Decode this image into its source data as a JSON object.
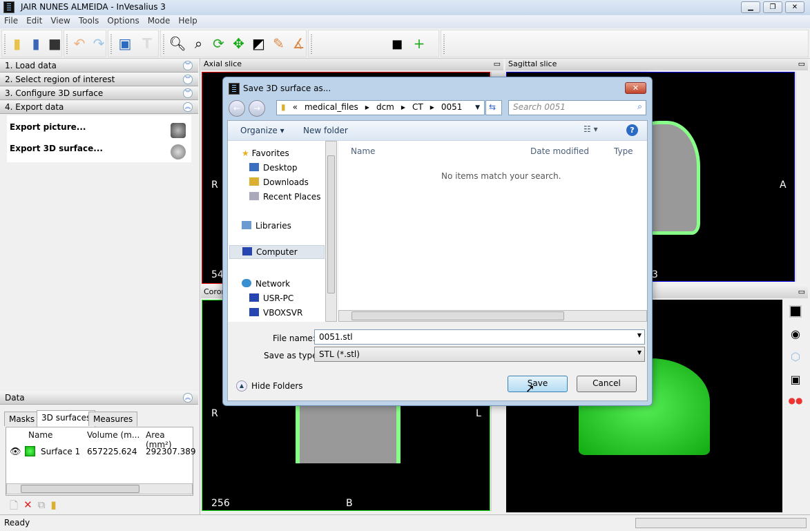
{
  "window": {
    "title": "JAIR NUNES ALMEIDA - InVesalius 3",
    "minimize": "▁",
    "restore": "❐",
    "close": "✕"
  },
  "menu": [
    "File",
    "Edit",
    "View",
    "Tools",
    "Options",
    "Mode",
    "Help"
  ],
  "toolbar": {
    "icons": [
      "import-folder",
      "import-dicom",
      "export",
      "undo",
      "redo",
      "layout",
      "text",
      "zoom",
      "zoom-select",
      "rotate",
      "pan",
      "contrast",
      "measure-distance",
      "measure-angle",
      "slice-tool",
      "add-mark"
    ]
  },
  "left_panel": {
    "sections": [
      {
        "label": "1. Load data"
      },
      {
        "label": "2. Select region of interest"
      },
      {
        "label": "3. Configure 3D surface"
      },
      {
        "label": "4. Export data"
      }
    ],
    "export_items": [
      "Export picture...",
      "Export 3D surface..."
    ],
    "data": {
      "title": "Data",
      "tabs": [
        "Masks",
        "3D surfaces",
        "Measures"
      ],
      "active_tab": "3D surfaces",
      "columns": [
        "Name",
        "Volume (m...",
        "Area (mm²)"
      ],
      "rows": [
        {
          "name": "Surface 1",
          "volume": "657225.624",
          "area": "292307.389",
          "color": "#2ecc2e"
        }
      ]
    }
  },
  "viewports": {
    "axial": {
      "title": "Axial slice",
      "left": "R",
      "slice": "54"
    },
    "sagittal": {
      "title": "Sagittal slice",
      "right": "A",
      "slice": "3"
    },
    "coronal": {
      "title": "Coronal slice",
      "title_visible": "Coron",
      "left": "R",
      "right": "L",
      "slice": "256",
      "bottom": "B"
    },
    "surface_color": "#33dd33"
  },
  "dialog": {
    "title": "Save 3D surface as...",
    "path": [
      "«",
      "medical_files",
      "dcm",
      "CT",
      "0051"
    ],
    "search_placeholder": "Search 0051",
    "organize": "Organize ▾",
    "new_folder": "New folder",
    "nav": {
      "favorites": "Favorites",
      "desktop": "Desktop",
      "downloads": "Downloads",
      "recent": "Recent Places",
      "libraries": "Libraries",
      "computer": "Computer",
      "network": "Network",
      "usr_pc": "USR-PC",
      "vboxsvr": "VBOXSVR"
    },
    "columns": [
      "Name",
      "Date modified",
      "Type"
    ],
    "empty_message": "No items match your search.",
    "file_name_label": "File name:",
    "file_name": "0051.stl",
    "save_type_label": "Save as type:",
    "save_type": "STL (*.stl)",
    "hide_folders": "Hide Folders",
    "save": "Save",
    "cancel": "Cancel"
  },
  "status": {
    "text": "Ready"
  }
}
